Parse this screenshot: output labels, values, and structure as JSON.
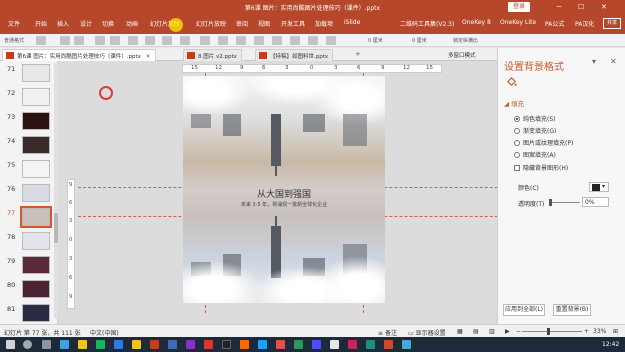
{
  "window": {
    "title": "第6课 图片：实用尚酷图片处理技巧（课件）.pptx",
    "login_label": "登录",
    "share_label": "共享"
  },
  "ribbon": {
    "tabs": [
      "文件",
      "开始",
      "插入",
      "设计",
      "切换",
      "动画",
      "幻灯片放映",
      "幻灯片放映",
      "审阅",
      "视图",
      "开发工具",
      "加载项",
      "iSlide",
      "二维码工具集(V2.3)",
      "OneKey 8",
      "OneKey Lite",
      "PA公式",
      "PA汉化"
    ]
  },
  "toolbar": {
    "left_text": "普通格式",
    "size_a": "0 厘米",
    "size_b": "0 厘米",
    "lock_label": "锁定纵横比",
    "multi_window": "多窗口模式"
  },
  "doc_tabs": [
    {
      "label": "第6课 图片：实用尚酷图片处理技巧（课件）.pptx",
      "active": true
    },
    {
      "label": "8.图片 v2.pptx",
      "active": false
    },
    {
      "label": "【特稿】如图料世.pptx",
      "active": false
    }
  ],
  "thumbnails": [
    {
      "num": "71",
      "color": "#e8e8e8"
    },
    {
      "num": "72",
      "color": "#f0f0f0"
    },
    {
      "num": "73",
      "color": "#2b1212"
    },
    {
      "num": "74",
      "color": "#3a2a2a"
    },
    {
      "num": "75",
      "color": "#f4f4f4"
    },
    {
      "num": "76",
      "color": "#d9dce2"
    },
    {
      "num": "77",
      "color": "#c9c0bb",
      "active": true
    },
    {
      "num": "78",
      "color": "#e1e4ea"
    },
    {
      "num": "79",
      "color": "#5a2a38"
    },
    {
      "num": "80",
      "color": "#4a2434"
    },
    {
      "num": "81",
      "color": "#2b2b44"
    }
  ],
  "ruler_h": [
    "15",
    "12",
    "9",
    "6",
    "3",
    "0",
    "3",
    "6",
    "9",
    "12",
    "15"
  ],
  "ruler_v": [
    "9",
    "6",
    "3",
    "0",
    "3",
    "6",
    "9"
  ],
  "slide": {
    "heading": "从大国到强国",
    "subheading": "未来 3-5 年，将涌现一批新全球化企业"
  },
  "format_panel": {
    "title": "设置背景格式",
    "section": "填充",
    "fill_options": [
      {
        "label": "纯色填充(S)",
        "selected": true
      },
      {
        "label": "渐变填充(G)",
        "selected": false
      },
      {
        "label": "图片或纹理填充(P)",
        "selected": false
      },
      {
        "label": "图案填充(A)",
        "selected": false
      }
    ],
    "hide_bg_label": "隐藏背景图形(H)",
    "color_label": "颜色(C)",
    "transparency_label": "透明度(T)",
    "transparency_value": "0%",
    "apply_all_label": "应用到全部(L)",
    "reset_label": "重置背景(B)"
  },
  "status": {
    "slide_info": "幻灯片 第 77 张，共 111 张",
    "language": "中文(中国)",
    "notes": "备注",
    "display": "显示器设置",
    "zoom": "33%"
  },
  "taskbar": {
    "time": "12:42"
  },
  "colors": {
    "accent": "#b7472a",
    "highlight": "#d0572e",
    "guide": "#d6604a"
  }
}
